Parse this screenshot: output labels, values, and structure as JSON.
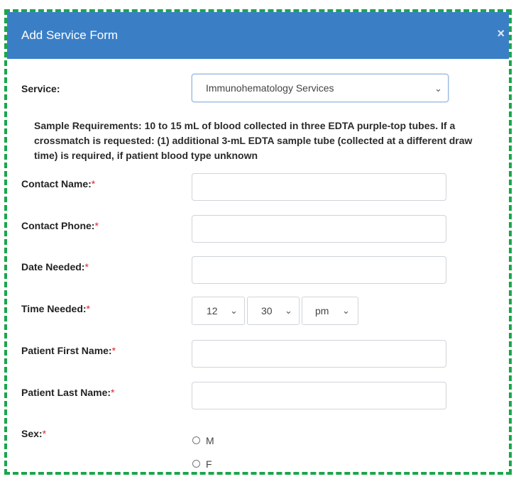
{
  "modal": {
    "title": "Add Service Form",
    "close_symbol": "×"
  },
  "service": {
    "label": "Service:",
    "selected": "Immunohematology Services"
  },
  "note": "Sample Requirements: 10 to 15 mL of blood collected in three EDTA purple-top tubes. If a crossmatch is requested: (1) additional 3-mL EDTA sample tube (collected at a different draw time) is required, if patient blood type unknown",
  "fields": {
    "contact_name": "Contact Name:",
    "contact_phone": "Contact Phone:",
    "date_needed": "Date Needed:",
    "time_needed": "Time Needed:",
    "patient_first": "Patient First Name:",
    "patient_last": "Patient Last Name:",
    "sex": "Sex:",
    "required_mark": "*"
  },
  "time": {
    "hour": "12",
    "minute": "30",
    "ampm": "pm"
  },
  "sex_options": [
    "M",
    "F"
  ],
  "colors": {
    "header": "#3a7fc6",
    "required": "#d9252b",
    "frame": "#1aa64a"
  },
  "icons": {
    "close": "close-icon",
    "chevron": "chevron-down-icon"
  }
}
